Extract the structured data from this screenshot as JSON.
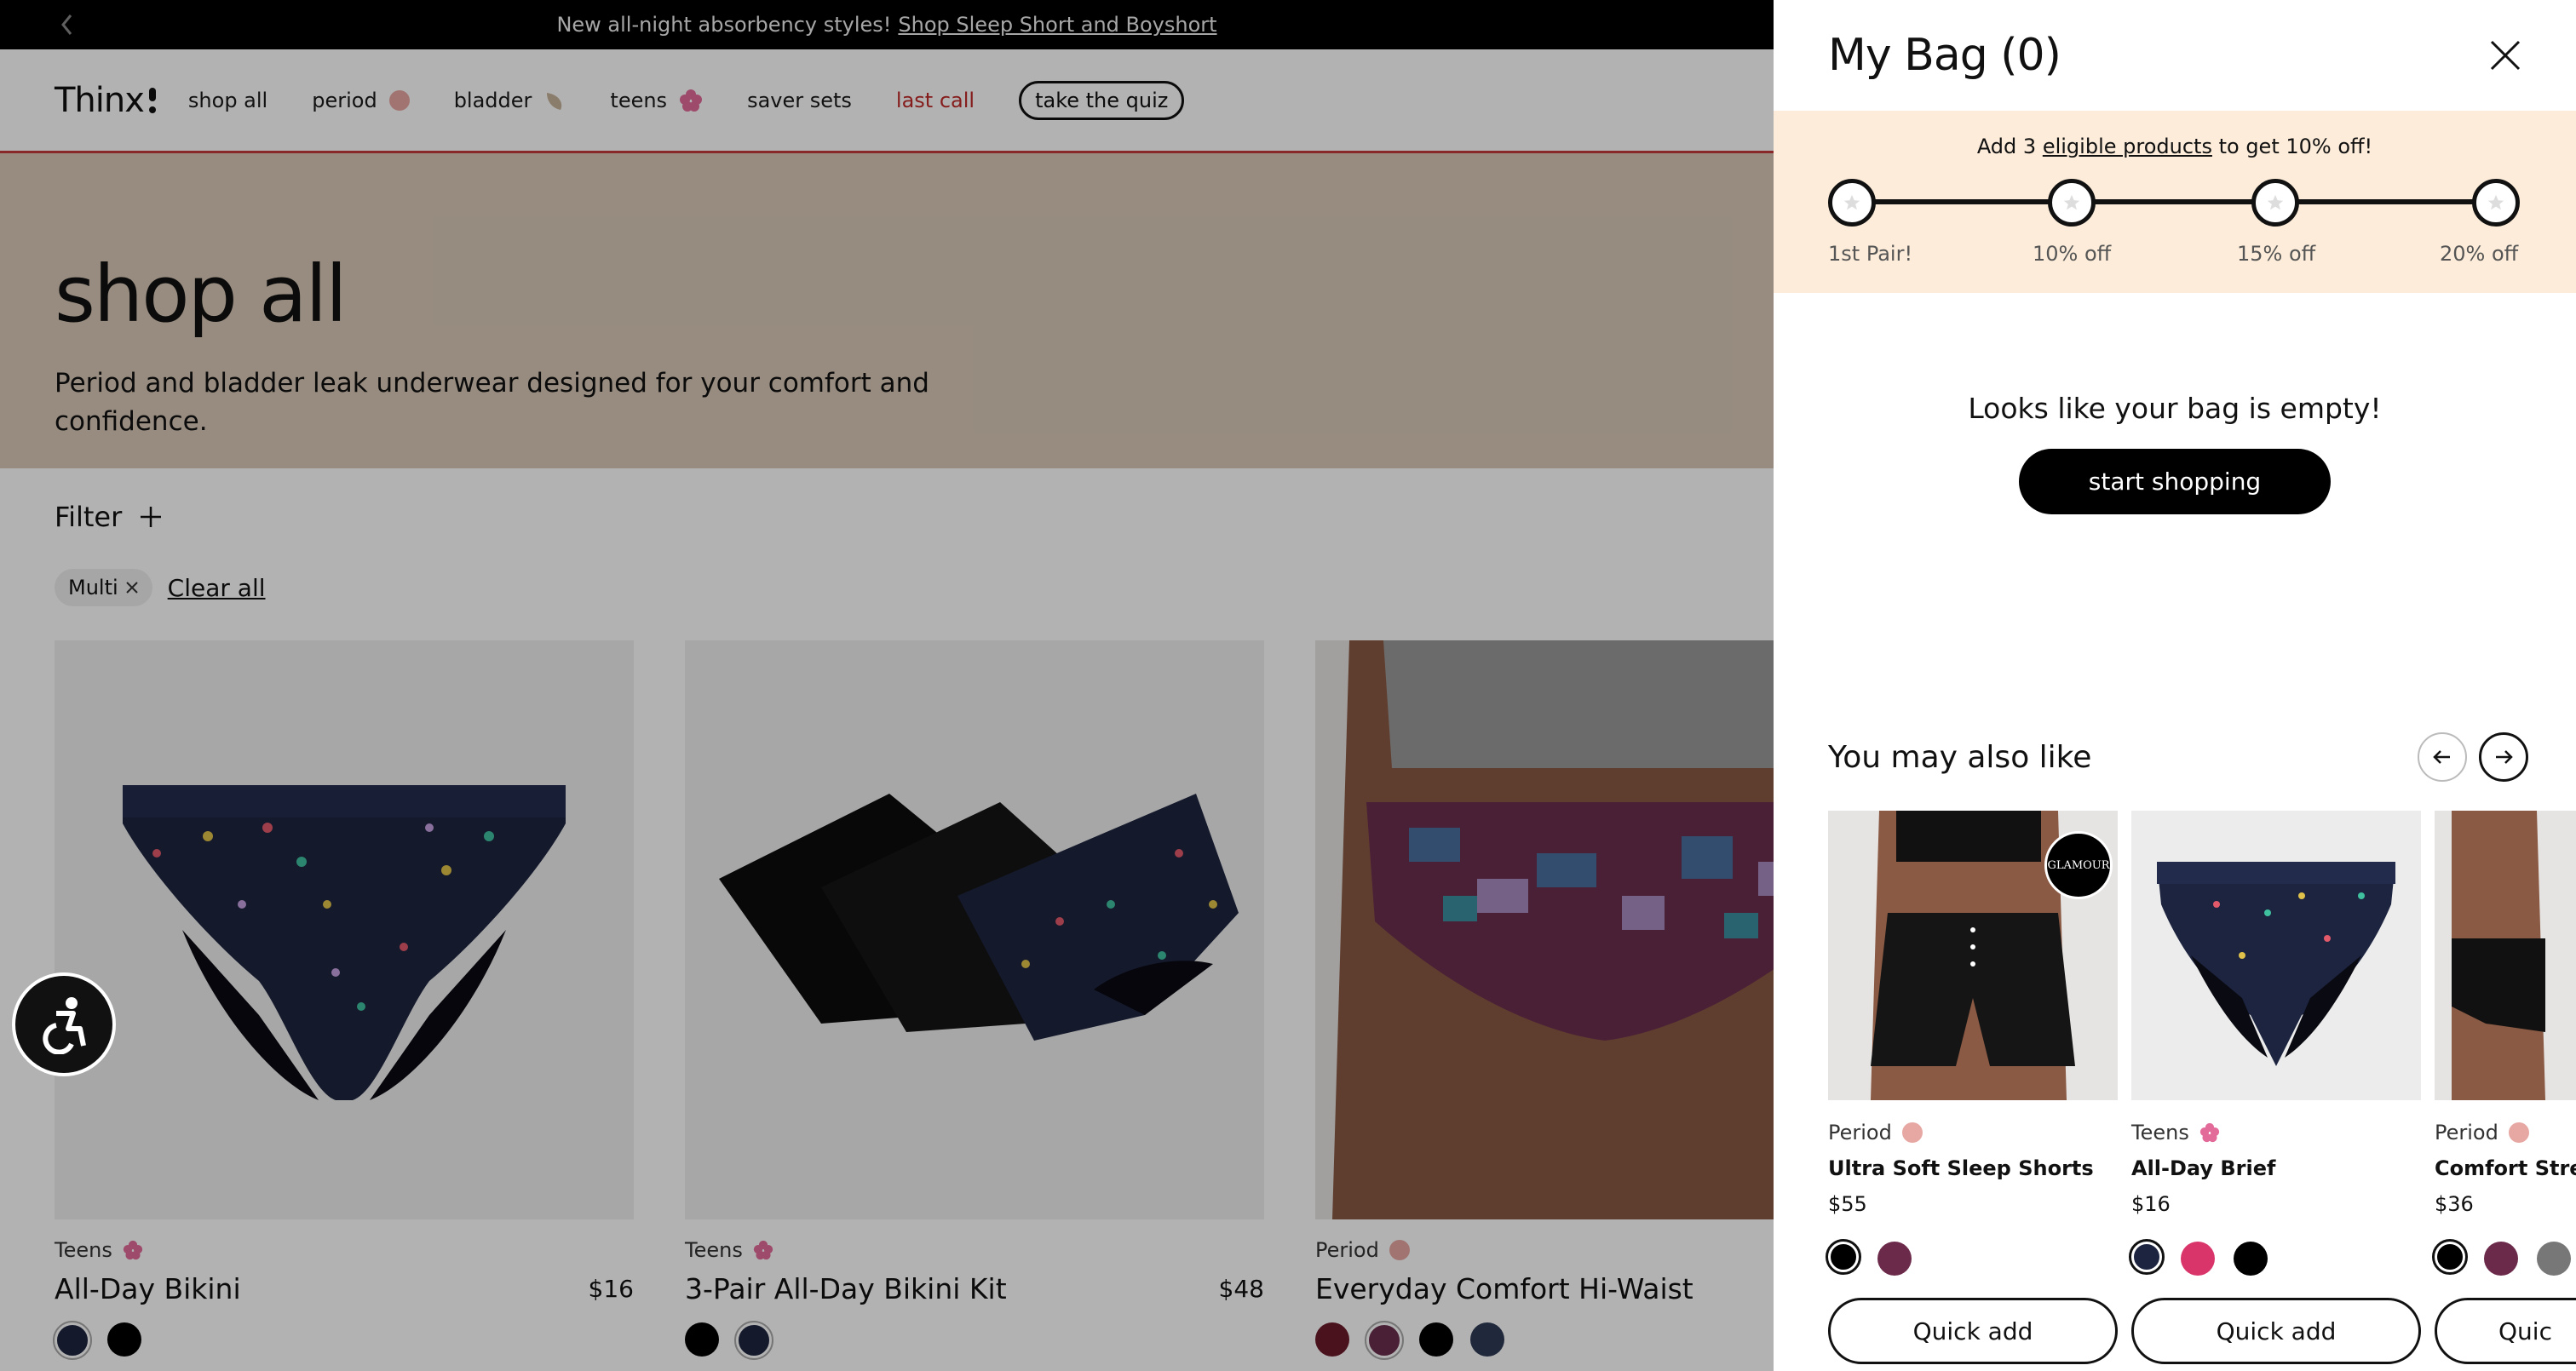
{
  "banner": {
    "text": "New all-night absorbency styles!",
    "link": "Shop Sleep Short and Boyshort"
  },
  "nav": {
    "logo": "Thinx",
    "items": [
      {
        "label": "shop all"
      },
      {
        "label": "period",
        "dot": "#e7a7a2"
      },
      {
        "label": "bladder",
        "dot": "#c8b49a"
      },
      {
        "label": "teens",
        "dot": "#e26b9a"
      },
      {
        "label": "saver sets"
      },
      {
        "label": "last call"
      }
    ],
    "quiz": "take the quiz"
  },
  "hero": {
    "title": "shop all",
    "subtitle": "Period and bladder leak underwear designed for your comfort and confidence."
  },
  "filters": {
    "label": "Filter",
    "chip": "Multi",
    "clear": "Clear all"
  },
  "products": [
    {
      "category": "Teens",
      "name": "All-Day Bikini",
      "price": "$16"
    },
    {
      "category": "Teens",
      "name": "3-Pair All-Day Bikini Kit",
      "price": "$48"
    },
    {
      "category": "Period",
      "name": "Everyday Comfort Hi-Waist",
      "price": ""
    }
  ],
  "bag": {
    "title": "My Bag (0)",
    "promo": {
      "prefix": "Add 3",
      "link": "eligible products",
      "suffix": "to get 10% off!",
      "steps": [
        "1st Pair!",
        "10% off",
        "15% off",
        "20% off"
      ]
    },
    "empty_text": "Looks like your bag is empty!",
    "cta": "start shopping",
    "ymal_title": "You may also like",
    "recs": [
      {
        "category": "Period",
        "name": "Ultra Soft Sleep Shorts",
        "price": "$55",
        "cta": "Quick add",
        "badge": "GLAMOUR"
      },
      {
        "category": "Teens",
        "name": "All-Day Brief",
        "price": "$16",
        "cta": "Quick add"
      },
      {
        "category": "Period",
        "name": "Comfort Stret",
        "price": "$36",
        "cta": "Quic"
      }
    ]
  },
  "colors": {
    "accent": "#c43a3a",
    "period": "#e7a7a2",
    "teens": "#e26b9a",
    "hero_bg": "#d9c9b7",
    "promo_bg": "#fcecd9"
  }
}
